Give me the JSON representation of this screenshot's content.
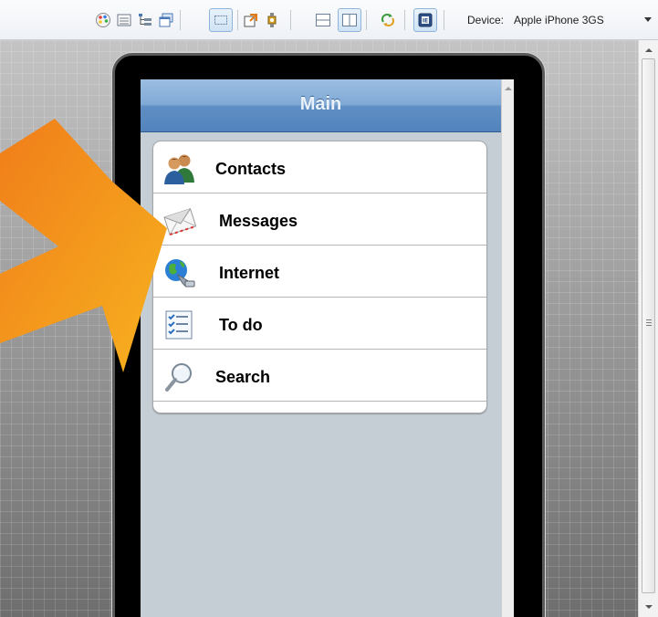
{
  "toolbar": {
    "icons": [
      "palette-icon",
      "list-view-icon",
      "tree-view-icon",
      "window-stack-icon",
      "frame-icon",
      "export-icon",
      "plugin-icon",
      "split-horizontal-icon",
      "split-vertical-icon",
      "refresh-icon",
      "device-frame-icon"
    ],
    "device_label": "Device:",
    "device_value": "Apple iPhone 3GS"
  },
  "screen": {
    "nav_title": "Main",
    "menu_items": [
      {
        "label": "Contacts",
        "icon": "contacts-icon"
      },
      {
        "label": "Messages",
        "icon": "envelope-icon"
      },
      {
        "label": "Internet",
        "icon": "globe-icon"
      },
      {
        "label": "To do",
        "icon": "checklist-icon"
      },
      {
        "label": "Search",
        "icon": "magnifier-icon"
      }
    ]
  },
  "colors": {
    "nav_bar": "#5f8fc4",
    "arrow": "#f39a1e",
    "screen_bg": "#c5cdd5"
  }
}
